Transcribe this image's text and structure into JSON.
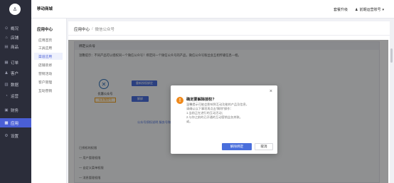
{
  "app": {
    "store_name": "移动商城",
    "logo_glyph": "♙"
  },
  "sidebar": {
    "items": [
      {
        "label": "概况",
        "icon": "⊙"
      },
      {
        "label": "店铺",
        "icon": "⌂"
      },
      {
        "label": "商品",
        "icon": "▤"
      },
      {
        "label": "订单",
        "icon": "▦"
      },
      {
        "label": "客户",
        "icon": "♟"
      },
      {
        "label": "数据",
        "icon": "▥"
      },
      {
        "label": "运营",
        "icon": "◔"
      },
      {
        "label": "财务",
        "icon": "▣"
      },
      {
        "label": "应用",
        "icon": "▩"
      },
      {
        "label": "设置",
        "icon": "⚙"
      }
    ]
  },
  "topbar": {
    "upgrade_label": "套餐升级",
    "user_label": "前期运营账号",
    "user_icon": "♟",
    "caret": "▾"
  },
  "subnav": {
    "title": "应用中心",
    "items": [
      "应用首页",
      "工具应用",
      "渠道应用",
      "店铺装修",
      "营销活动",
      "客户管理",
      "互动营销"
    ]
  },
  "breadcrumb": {
    "root": "应用中心",
    "sep": "/",
    "current": "微信公众号"
  },
  "panel": {
    "head": "绑定公众号",
    "desc": "温馨提示：不同产品可以授权同一个微信公众号！绑定同一个微信公众号的产品，微信公众号粉丝会互相传输信息—相。",
    "account_name": "优惠公众号",
    "auth_badge": "认证服务号",
    "btn1": "重新授权绑定",
    "btn2": "解绑",
    "link": "公众号授权说明 服务号和订阅号的区别",
    "list": [
      "已授权的权限",
      "— 用户管理权限",
      "— 自定义菜单权限",
      "— 消息管理权限"
    ]
  },
  "modal": {
    "title": "确定要解除授权?",
    "warn_glyph": "!",
    "close_glyph": "×",
    "lines": [
      "温馨提示可能会影响到互动功能的产品及信息，",
      "请确认以下事项再点击“解除”操作：",
      "1.当前正在进行的互动活动；",
      "2.与你之前的已开通的互动营销业务关联。",
      "或。"
    ],
    "confirm_label": "解除绑定",
    "cancel_label": "取消"
  }
}
